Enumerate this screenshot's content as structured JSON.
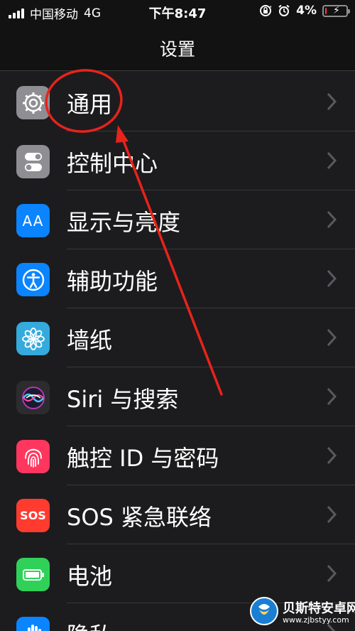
{
  "status_bar": {
    "carrier": "中国移动",
    "network": "4G",
    "time": "下午8:47",
    "battery_percent_text": "4%",
    "battery_level": 0.04,
    "icons": [
      "signal-icon",
      "orientation-lock-icon",
      "alarm-icon",
      "battery-charging-icon"
    ]
  },
  "nav": {
    "title": "设置"
  },
  "settings": {
    "items": [
      {
        "label": "通用",
        "icon": "gear-icon",
        "color": "#8e8e93"
      },
      {
        "label": "控制中心",
        "icon": "toggles-icon",
        "color": "#8e8e93"
      },
      {
        "label": "显示与亮度",
        "icon": "text-size-icon",
        "color": "#0a84ff",
        "icon_text": "AA"
      },
      {
        "label": "辅助功能",
        "icon": "accessibility-icon",
        "color": "#0a84ff"
      },
      {
        "label": "墙纸",
        "icon": "flower-icon",
        "color": "#35aadc"
      },
      {
        "label": "Siri 与搜索",
        "icon": "siri-icon",
        "color": "#2c2c2e"
      },
      {
        "label": "触控 ID 与密码",
        "icon": "fingerprint-icon",
        "color": "#ff375f"
      },
      {
        "label": "SOS 紧急联络",
        "icon": "sos-icon",
        "color": "#ff3b30",
        "icon_text": "SOS"
      },
      {
        "label": "电池",
        "icon": "battery-icon",
        "color": "#30d158"
      },
      {
        "label": "隐私",
        "icon": "hand-icon",
        "color": "#0a84ff"
      }
    ]
  },
  "annotation": {
    "color": "#e8231b"
  },
  "watermark": {
    "name": "贝斯特安卓网",
    "url": "www.zjbstyy.com"
  }
}
